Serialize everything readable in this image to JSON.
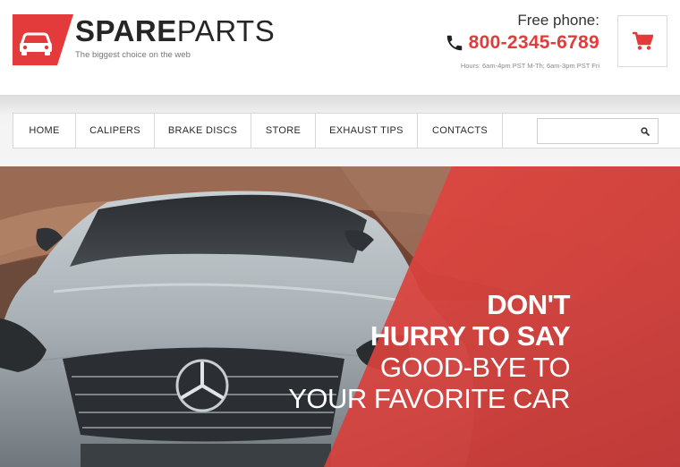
{
  "brand": {
    "name_bold": "SPARE",
    "name_light": "PARTS",
    "tagline": "The biggest choice on the web"
  },
  "contact": {
    "phone_label": "Free phone:",
    "phone_number": "800-2345-6789",
    "hours": "Hours: 6am-4pm PST M-Th; 6am-3pm PST Fri"
  },
  "colors": {
    "accent": "#e33b3b",
    "text_dark": "#262626",
    "nav_border": "#d8d8d8"
  },
  "icons": {
    "logo": "car-icon",
    "phone": "phone-icon",
    "cart": "shopping-cart-icon",
    "search": "search-icon"
  },
  "nav": {
    "items": [
      {
        "label": "HOME"
      },
      {
        "label": "CALIPERS"
      },
      {
        "label": "BRAKE DISCS"
      },
      {
        "label": "STORE"
      },
      {
        "label": "EXHAUST TIPS"
      },
      {
        "label": "CONTACTS"
      }
    ],
    "search_placeholder": ""
  },
  "hero": {
    "line1": "DON'T",
    "line2": "HURRY TO SAY",
    "line3": "GOOD-BYE TO",
    "line4": "YOUR FAVORITE CAR"
  }
}
